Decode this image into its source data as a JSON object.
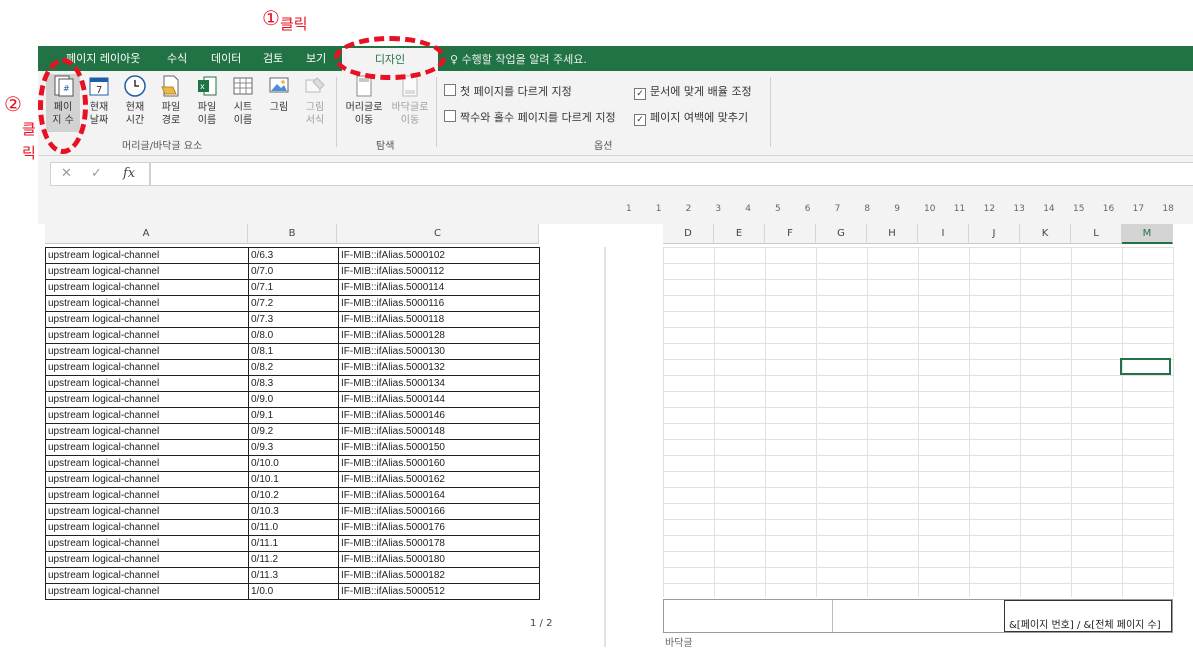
{
  "annotations": {
    "step1_number": "①",
    "step1_text": "클릭",
    "step2_number": "②",
    "step2_text_line1": "클",
    "step2_text_line2": "릭"
  },
  "tabs": [
    {
      "label": "페이지 레이아웃"
    },
    {
      "label": "수식"
    },
    {
      "label": "데이터"
    },
    {
      "label": "검토"
    },
    {
      "label": "보기"
    }
  ],
  "active_tab": "디자인",
  "tell_me": "수행할 작업을 알려 주세요.",
  "ribbon": {
    "buttons": [
      {
        "line1": "페이",
        "line2": "지 수",
        "icon": "page-number-icon"
      },
      {
        "line1": "현재",
        "line2": "날짜",
        "icon": "calendar-icon"
      },
      {
        "line1": "현재",
        "line2": "시간",
        "icon": "clock-icon"
      },
      {
        "line1": "파일",
        "line2": "경로",
        "icon": "file-path-icon"
      },
      {
        "line1": "파일",
        "line2": "이름",
        "icon": "file-name-icon"
      },
      {
        "line1": "시트",
        "line2": "이름",
        "icon": "sheet-name-icon"
      },
      {
        "line1": "그림",
        "line2": "",
        "icon": "picture-icon"
      },
      {
        "line1": "그림",
        "line2": "서식",
        "icon": "format-picture-icon"
      }
    ],
    "group_header_footer": "머리글/바닥글 요소",
    "nav_buttons": [
      {
        "line1": "머리글로",
        "line2": "이동"
      },
      {
        "line1": "바닥글로",
        "line2": "이동"
      }
    ],
    "group_nav": "탐색",
    "options": [
      {
        "label": "첫 페이지를 다르게 지정",
        "checked": false
      },
      {
        "label": "짝수와 홀수 페이지를 다르게 지정",
        "checked": false
      },
      {
        "label": "문서에 맞게 배율 조정",
        "checked": true
      },
      {
        "label": "페이지 여백에 맞추기",
        "checked": true
      }
    ],
    "group_options": "옵션"
  },
  "formula_bar": {
    "cancel": "✕",
    "enter": "✓",
    "fx": "fx",
    "value": ""
  },
  "ruler": [
    "1",
    "1",
    "2",
    "3",
    "4",
    "5",
    "6",
    "7",
    "8",
    "9",
    "10",
    "11",
    "12",
    "13",
    "14",
    "15",
    "16",
    "17",
    "18"
  ],
  "columns_left": [
    "A",
    "B",
    "C"
  ],
  "columns_right": [
    "D",
    "E",
    "F",
    "G",
    "H",
    "I",
    "J",
    "K",
    "L",
    "M"
  ],
  "selected_column": "M",
  "rows": [
    [
      "upstream logical-channel",
      "0/6.3",
      "IF-MIB::ifAlias.5000102"
    ],
    [
      "upstream logical-channel",
      "0/7.0",
      "IF-MIB::ifAlias.5000112"
    ],
    [
      "upstream logical-channel",
      "0/7.1",
      "IF-MIB::ifAlias.5000114"
    ],
    [
      "upstream logical-channel",
      "0/7.2",
      "IF-MIB::ifAlias.5000116"
    ],
    [
      "upstream logical-channel",
      "0/7.3",
      "IF-MIB::ifAlias.5000118"
    ],
    [
      "upstream logical-channel",
      "0/8.0",
      "IF-MIB::ifAlias.5000128"
    ],
    [
      "upstream logical-channel",
      "0/8.1",
      "IF-MIB::ifAlias.5000130"
    ],
    [
      "upstream logical-channel",
      "0/8.2",
      "IF-MIB::ifAlias.5000132"
    ],
    [
      "upstream logical-channel",
      "0/8.3",
      "IF-MIB::ifAlias.5000134"
    ],
    [
      "upstream logical-channel",
      "0/9.0",
      "IF-MIB::ifAlias.5000144"
    ],
    [
      "upstream logical-channel",
      "0/9.1",
      "IF-MIB::ifAlias.5000146"
    ],
    [
      "upstream logical-channel",
      "0/9.2",
      "IF-MIB::ifAlias.5000148"
    ],
    [
      "upstream logical-channel",
      "0/9.3",
      "IF-MIB::ifAlias.5000150"
    ],
    [
      "upstream logical-channel",
      "0/10.0",
      "IF-MIB::ifAlias.5000160"
    ],
    [
      "upstream logical-channel",
      "0/10.1",
      "IF-MIB::ifAlias.5000162"
    ],
    [
      "upstream logical-channel",
      "0/10.2",
      "IF-MIB::ifAlias.5000164"
    ],
    [
      "upstream logical-channel",
      "0/10.3",
      "IF-MIB::ifAlias.5000166"
    ],
    [
      "upstream logical-channel",
      "0/11.0",
      "IF-MIB::ifAlias.5000176"
    ],
    [
      "upstream logical-channel",
      "0/11.1",
      "IF-MIB::ifAlias.5000178"
    ],
    [
      "upstream logical-channel",
      "0/11.2",
      "IF-MIB::ifAlias.5000180"
    ],
    [
      "upstream logical-channel",
      "0/11.3",
      "IF-MIB::ifAlias.5000182"
    ],
    [
      "upstream logical-channel",
      "1/0.0",
      "IF-MIB::ifAlias.5000512"
    ]
  ],
  "page_indicator": "1 / 2",
  "footer": {
    "right_code": "&[페이지 번호] / &[전체 페이지 수]",
    "label": "바닥글"
  },
  "colors": {
    "excel_green": "#217346",
    "annotation_red": "#e81123"
  }
}
